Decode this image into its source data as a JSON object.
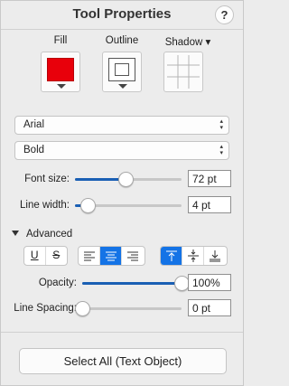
{
  "panel": {
    "title": "Tool Properties",
    "help_label": "?"
  },
  "swatches": {
    "fill_label": "Fill",
    "outline_label": "Outline",
    "shadow_label": "Shadow",
    "fill_color": "#e8000b",
    "shadow_menu_arrow": "▾"
  },
  "font": {
    "family": "Arial",
    "style": "Bold",
    "arrows": "▴▾"
  },
  "font_size": {
    "label": "Font size:",
    "value": "72 pt",
    "fraction": 0.48
  },
  "line_width": {
    "label": "Line width:",
    "value": "4 pt",
    "fraction": 0.12
  },
  "advanced": {
    "label": "Advanced",
    "expanded": true,
    "underline_label": "U",
    "strike_label": "S",
    "text_align_selected": "center",
    "vertical_align_selected": "top"
  },
  "opacity": {
    "label": "Opacity:",
    "value": "100%",
    "fraction": 1.0
  },
  "line_spacing": {
    "label": "Line Spacing:",
    "value": "0 pt",
    "fraction": 0.0
  },
  "actions": {
    "select_all_label": "Select All (Text Object)"
  },
  "colors": {
    "accent": "#1473e6",
    "slider_fill": "#1a5fb4"
  }
}
